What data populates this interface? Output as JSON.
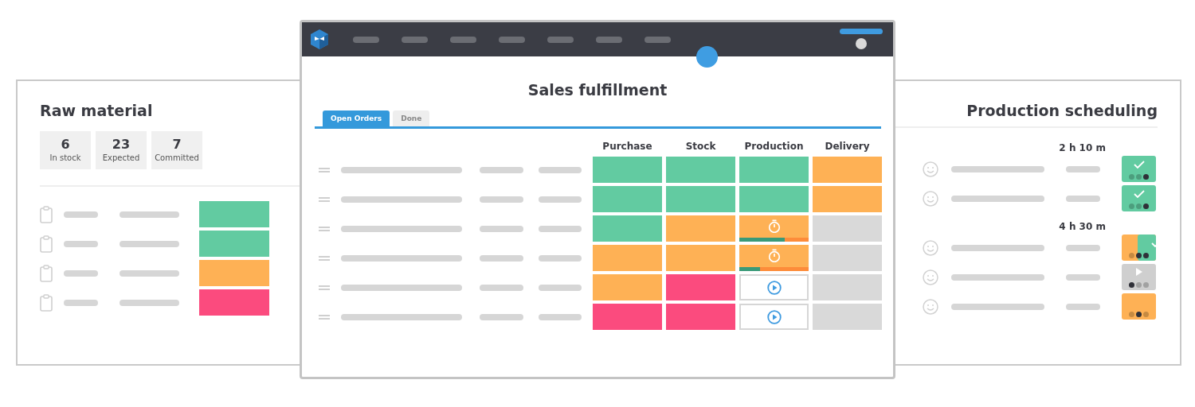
{
  "raw_material": {
    "title": "Raw material",
    "stats": [
      {
        "value": "6",
        "label": "In stock"
      },
      {
        "value": "23",
        "label": "Expected"
      },
      {
        "value": "7",
        "label": "Committed"
      }
    ],
    "rows": [
      {
        "color": "#62cba1"
      },
      {
        "color": "#62cba1"
      },
      {
        "color": "#feb155"
      },
      {
        "color": "#fb4b7e"
      }
    ]
  },
  "sales": {
    "title": "Sales fulfillment",
    "tabs": [
      {
        "label": "Open Orders",
        "selected": true
      },
      {
        "label": "Done",
        "selected": false
      }
    ],
    "columns": [
      "Purchase",
      "Stock",
      "Production",
      "Delivery"
    ],
    "rows": [
      {
        "cells": [
          {
            "kind": "status",
            "color": "#62cba1"
          },
          {
            "kind": "status",
            "color": "#62cba1"
          },
          {
            "kind": "status",
            "color": "#62cba1"
          },
          {
            "kind": "status",
            "color": "#feb155"
          }
        ]
      },
      {
        "cells": [
          {
            "kind": "status",
            "color": "#62cba1"
          },
          {
            "kind": "status",
            "color": "#62cba1"
          },
          {
            "kind": "status",
            "color": "#62cba1"
          },
          {
            "kind": "status",
            "color": "#feb155"
          }
        ]
      },
      {
        "cells": [
          {
            "kind": "status",
            "color": "#62cba1"
          },
          {
            "kind": "status",
            "color": "#feb155"
          },
          {
            "kind": "timer",
            "color": "#feb155",
            "level": 0.65
          },
          {
            "kind": "status",
            "color": "#d9d9d9"
          }
        ]
      },
      {
        "cells": [
          {
            "kind": "status",
            "color": "#feb155"
          },
          {
            "kind": "status",
            "color": "#feb155"
          },
          {
            "kind": "timer",
            "color": "#feb155",
            "level": 0.3
          },
          {
            "kind": "status",
            "color": "#d9d9d9"
          }
        ]
      },
      {
        "cells": [
          {
            "kind": "status",
            "color": "#feb155"
          },
          {
            "kind": "status",
            "color": "#fb4b7e"
          },
          {
            "kind": "play"
          },
          {
            "kind": "status",
            "color": "#d9d9d9"
          }
        ]
      },
      {
        "cells": [
          {
            "kind": "status",
            "color": "#fb4b7e"
          },
          {
            "kind": "status",
            "color": "#fb4b7e"
          },
          {
            "kind": "play"
          },
          {
            "kind": "status",
            "color": "#d9d9d9"
          }
        ]
      }
    ]
  },
  "scheduling": {
    "title": "Production scheduling",
    "groups": [
      {
        "duration": "2 h 10 m",
        "rows": [
          {
            "kind": "done",
            "dots": [
              false,
              false,
              true
            ]
          },
          {
            "kind": "done",
            "dots": [
              false,
              false,
              true
            ]
          }
        ]
      },
      {
        "duration": "4 h 30 m",
        "rows": [
          {
            "kind": "split",
            "dots": [
              false,
              true,
              true
            ]
          },
          {
            "kind": "play",
            "dots": [
              true,
              false,
              false
            ]
          },
          {
            "kind": "pending",
            "dots": [
              false,
              true,
              false
            ]
          }
        ]
      }
    ]
  }
}
